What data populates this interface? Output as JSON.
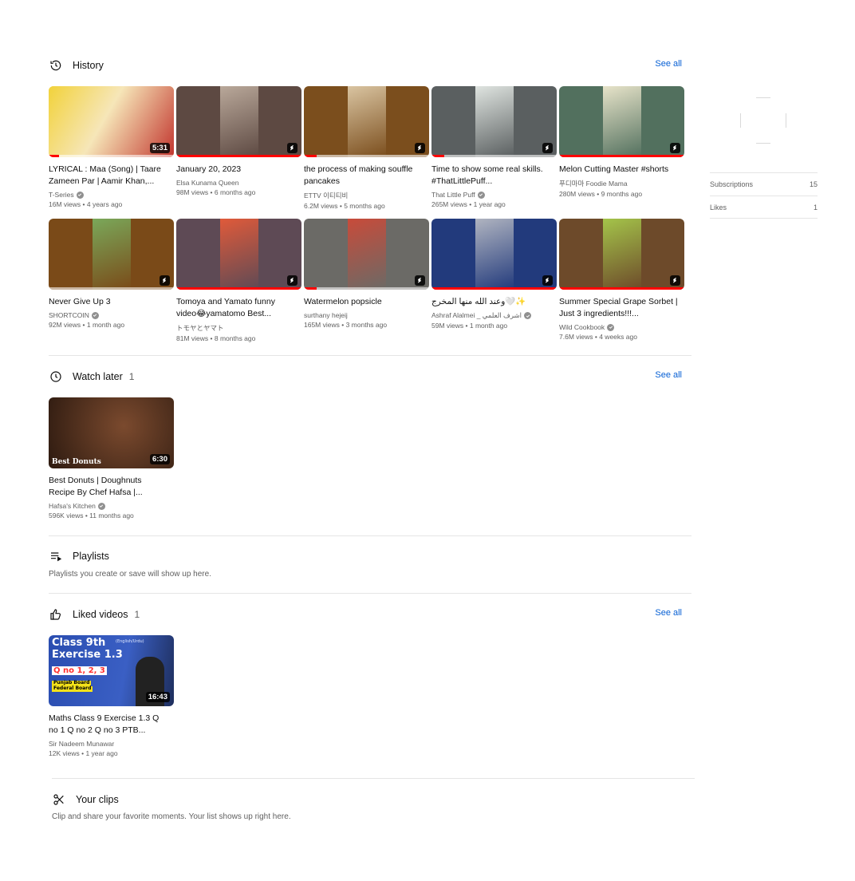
{
  "history": {
    "title": "History",
    "see_all": "See all",
    "items": [
      {
        "title": "LYRICAL : Maa (Song) | Taare Zameen Par | Aamir Khan,...",
        "channel": "T-Series",
        "verified": true,
        "meta": "16M views • 4 years ago",
        "duration": "5:31",
        "type": "video",
        "progress": 0.08,
        "colors": [
          "#f2d23a",
          "#c2352e"
        ]
      },
      {
        "title": "January 20, 2023",
        "channel": "Elsa Kunama Queen",
        "verified": false,
        "meta": "98M views • 6 months ago",
        "type": "short",
        "progress": 1.0,
        "colors": [
          "#5d4942",
          "#b9a89a"
        ]
      },
      {
        "title": "the process of making souffle pancakes",
        "channel": "ETTV 이티티비",
        "verified": false,
        "meta": "6.2M views • 5 months ago",
        "type": "short",
        "progress": 0.1,
        "colors": [
          "#7b4e1d",
          "#d9c4a1"
        ]
      },
      {
        "title": "Time to show some real skills. #ThatLittlePuff...",
        "channel": "That Little Puff",
        "verified": true,
        "meta": "265M views • 1 year ago",
        "type": "short",
        "progress": 0.1,
        "colors": [
          "#5a5f60",
          "#dfe4e0"
        ]
      },
      {
        "title": "Melon Cutting Master #shorts",
        "channel": "푸디마마 Foodie Mama",
        "verified": false,
        "meta": "280M views • 9 months ago",
        "type": "short",
        "progress": 1.0,
        "colors": [
          "#52705e",
          "#e7e3c9"
        ]
      },
      {
        "title": "Never Give Up 3",
        "channel": "SHORTCOIN",
        "verified": true,
        "meta": "92M views • 1 month ago",
        "type": "short",
        "progress": 0.0,
        "colors": [
          "#7a4a18",
          "#7aa85a"
        ]
      },
      {
        "title": "Tomoya and Yamato funny video😂yamatomo Best...",
        "channel": "トモヤとヤマト",
        "verified": false,
        "meta": "81M views • 8 months ago",
        "type": "short",
        "progress": 1.0,
        "colors": [
          "#5e4a55",
          "#e05a3a"
        ]
      },
      {
        "title": "Watermelon popsicle",
        "channel": "surthany hejeij",
        "verified": false,
        "meta": "165M views • 3 months ago",
        "type": "short",
        "progress": 0.1,
        "colors": [
          "#6b6a66",
          "#c84b3a"
        ]
      },
      {
        "title": "وعند الله منها المخرج🤍✨",
        "channel": "Ashraf Alalmei _ اشرف العلمي",
        "verified": true,
        "meta": "59M views • 1 month ago",
        "type": "short",
        "progress": 1.0,
        "colors": [
          "#223a7c",
          "#b0b4c0"
        ]
      },
      {
        "title": "Summer Special Grape Sorbet | Just 3 ingredients!!!...",
        "channel": "Wild Cookbook",
        "verified": true,
        "meta": "7.6M views • 4 weeks ago",
        "type": "short",
        "progress": 1.0,
        "colors": [
          "#6d4a2a",
          "#a4c44a"
        ]
      }
    ]
  },
  "watch_later": {
    "title": "Watch later",
    "count": "1",
    "see_all": "See all",
    "items": [
      {
        "title": "Best Donuts | Doughnuts Recipe By Chef Hafsa |...",
        "channel": "Hafsa's Kitchen",
        "verified": true,
        "meta": "596K views • 11 months ago",
        "duration": "6:30",
        "thumb_text": "Best Donuts"
      }
    ]
  },
  "playlists": {
    "title": "Playlists",
    "empty": "Playlists you create or save will show up here."
  },
  "liked": {
    "title": "Liked videos",
    "count": "1",
    "see_all": "See all",
    "items": [
      {
        "title": "Maths Class 9 Exercise 1.3 Q no 1 Q no 2 Q no 3 PTB...",
        "channel": "Sir Nadeem Munawar",
        "verified": false,
        "meta": "12K views • 1 year ago",
        "duration": "16:43",
        "thumb": {
          "line1": "Class 9th",
          "small": "(English/Urdu)",
          "line2": "Exercise 1.3",
          "line3": "Q no 1, 2, 3",
          "tag1": "Punjab Board",
          "tag2": "Federal Board"
        }
      }
    ]
  },
  "clips": {
    "title": "Your clips",
    "empty": "Clip and share your favorite moments. Your list shows up right here."
  },
  "stats": [
    {
      "label": "Subscriptions",
      "value": "15"
    },
    {
      "label": "Likes",
      "value": "1"
    }
  ],
  "colors": {
    "accent_link": "#065fd4",
    "progress": "#ff0000"
  }
}
